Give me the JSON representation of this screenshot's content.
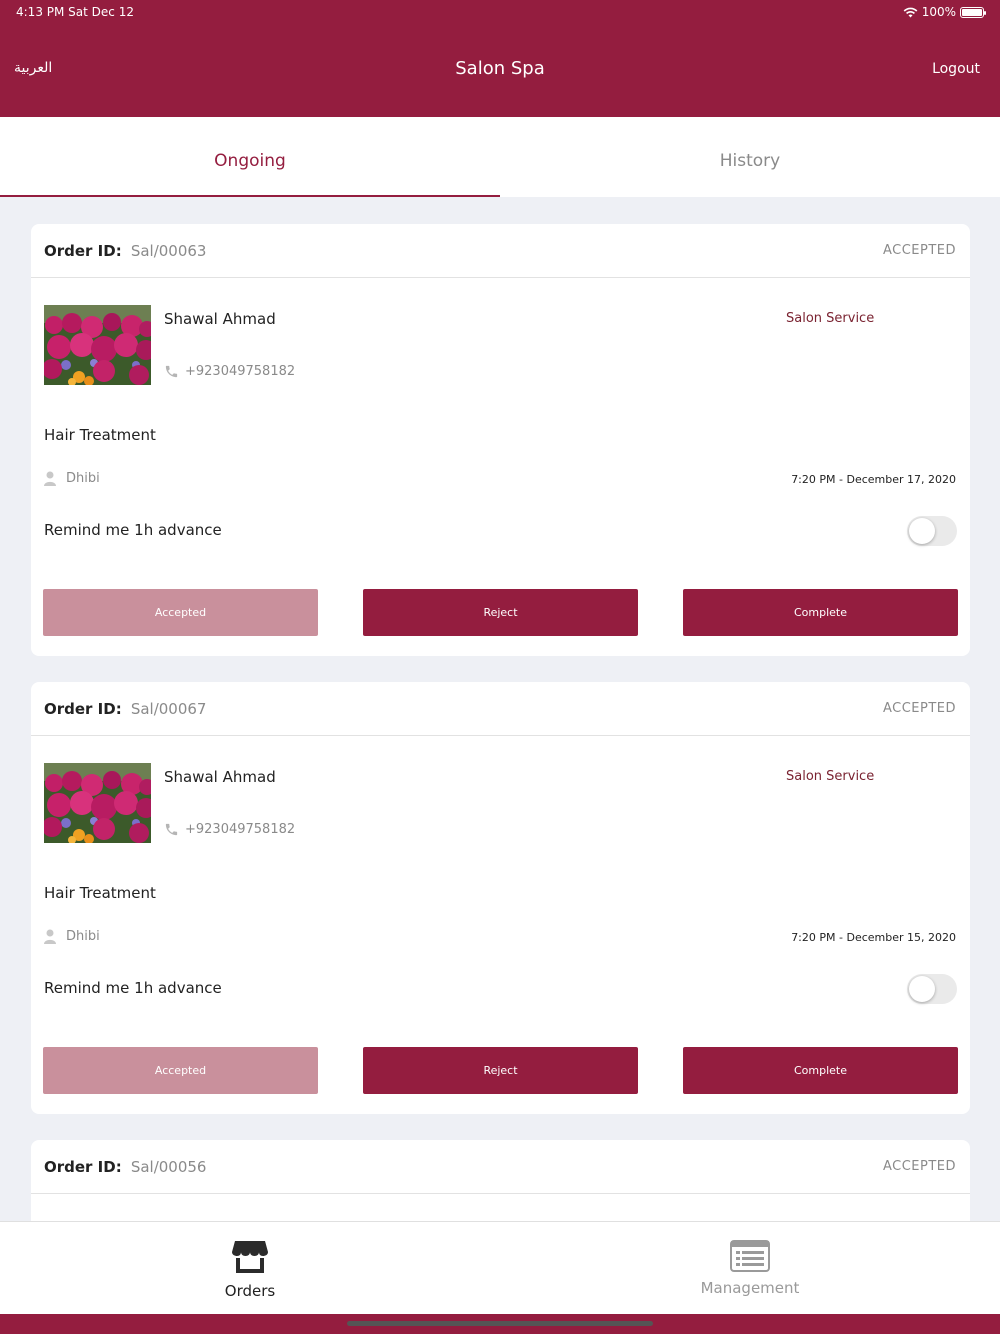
{
  "status_bar": {
    "time": "4:13 PM   Sat Dec 12",
    "battery": "100%"
  },
  "header": {
    "lang_label": "العربية",
    "title": "Salon Spa",
    "logout_label": "Logout"
  },
  "tabs": [
    {
      "label": "Ongoing"
    },
    {
      "label": "History"
    }
  ],
  "colors": {
    "brand": "#941d3f",
    "accepted_btn": "#c9909c",
    "service_text": "#7a2331"
  },
  "orders": [
    {
      "order_label": "Order ID:",
      "order_id": "Sal/00063",
      "status": "ACCEPTED",
      "customer_name": "Shawal Ahmad",
      "service_type": "Salon Service",
      "phone": "+923049758182",
      "service_name": "Hair Treatment",
      "staff": "Dhibi",
      "datetime": "7:20 PM - December 17, 2020",
      "remind_label": "Remind me 1h advance",
      "remind_on": false,
      "btn_accepted": "Accepted",
      "btn_reject": "Reject",
      "btn_complete": "Complete"
    },
    {
      "order_label": "Order ID:",
      "order_id": "Sal/00067",
      "status": "ACCEPTED",
      "customer_name": "Shawal Ahmad",
      "service_type": "Salon Service",
      "phone": "+923049758182",
      "service_name": "Hair Treatment",
      "staff": "Dhibi",
      "datetime": "7:20 PM - December 15, 2020",
      "remind_label": "Remind me 1h advance",
      "remind_on": false,
      "btn_accepted": "Accepted",
      "btn_reject": "Reject",
      "btn_complete": "Complete"
    },
    {
      "order_label": "Order ID:",
      "order_id": "Sal/00056",
      "status": "ACCEPTED"
    }
  ],
  "bottom_nav": [
    {
      "label": "Orders",
      "icon": "store-icon"
    },
    {
      "label": "Management",
      "icon": "list-icon"
    }
  ]
}
